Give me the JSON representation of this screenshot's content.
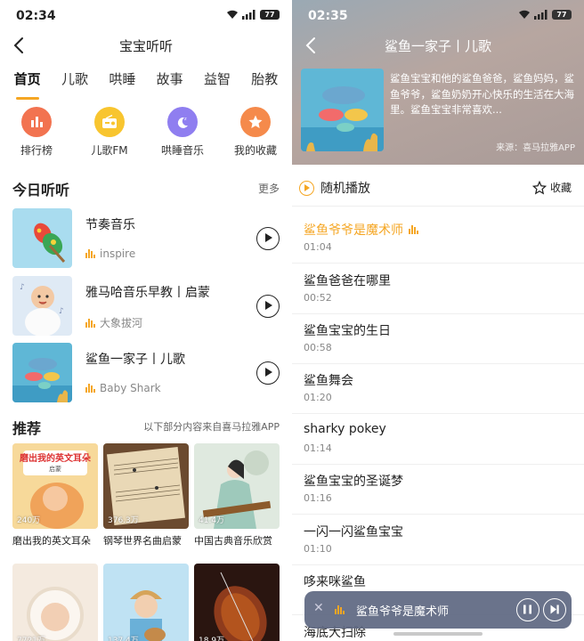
{
  "left": {
    "status": {
      "time": "02:34",
      "battery": "77"
    },
    "nav": {
      "title": "宝宝听听"
    },
    "tabs": [
      "首页",
      "儿歌",
      "哄睡",
      "故事",
      "益智",
      "胎教"
    ],
    "quick": [
      {
        "label": "排行榜",
        "icon": "bar-chart-icon",
        "color": "#f27350"
      },
      {
        "label": "儿歌FM",
        "icon": "radio-icon",
        "color": "#f8c52f"
      },
      {
        "label": "哄睡音乐",
        "icon": "moon-sleep-icon",
        "color": "#8f7ef0"
      },
      {
        "label": "我的收藏",
        "icon": "star-icon",
        "color": "#f58a4b"
      }
    ],
    "today": {
      "title": "今日听听",
      "more": "更多",
      "items": [
        {
          "title": "节奏音乐",
          "sub": "inspire"
        },
        {
          "title": "雅马哈音乐早教丨启蒙",
          "sub": "大象拔河"
        },
        {
          "title": "鲨鱼一家子丨儿歌",
          "sub": "Baby Shark"
        }
      ]
    },
    "recommend": {
      "title": "推荐",
      "note": "以下部分内容来自喜马拉雅APP",
      "cards": [
        {
          "title": "磨出我的英文耳朵",
          "count": "240万",
          "cover_text": "磨出我的英文耳朵",
          "cover_tag": "启蒙"
        },
        {
          "title": "钢琴世界名曲启蒙",
          "count": "376.3万"
        },
        {
          "title": "中国古典音乐欣赏",
          "count": "41.4万"
        }
      ],
      "cards2": [
        {
          "count": "7721万"
        },
        {
          "count": "137.4万"
        },
        {
          "count": "18.9万"
        }
      ]
    }
  },
  "right": {
    "status": {
      "time": "02:35",
      "battery": "77"
    },
    "nav": {
      "title": "鲨鱼一家子丨儿歌"
    },
    "description": "鲨鱼宝宝和他的鲨鱼爸爸，鲨鱼妈妈，鲨鱼爷爷，鲨鱼奶奶开心快乐的生活在大海里。鲨鱼宝宝非常喜欢...",
    "source": "来源：喜马拉雅APP",
    "shuffle": "随机播放",
    "favorite": "收藏",
    "tracks": [
      {
        "name": "鲨鱼爷爷是魔术师",
        "duration": "01:04"
      },
      {
        "name": "鲨鱼爸爸在哪里",
        "duration": "00:52"
      },
      {
        "name": "鲨鱼宝宝的生日",
        "duration": "00:58"
      },
      {
        "name": "鲨鱼舞会",
        "duration": "01:20"
      },
      {
        "name": "sharky pokey",
        "duration": "01:14"
      },
      {
        "name": "鲨鱼宝宝的圣诞梦",
        "duration": "01:16"
      },
      {
        "name": "一闪一闪鲨鱼宝宝",
        "duration": "01:10"
      },
      {
        "name": "哆来咪鲨鱼",
        "duration": ""
      },
      {
        "name": "海底大扫除",
        "duration": ""
      }
    ],
    "mini": {
      "title": "鲨鱼爷爷是魔术师"
    },
    "colors": {
      "accent": "#f5a623"
    }
  }
}
